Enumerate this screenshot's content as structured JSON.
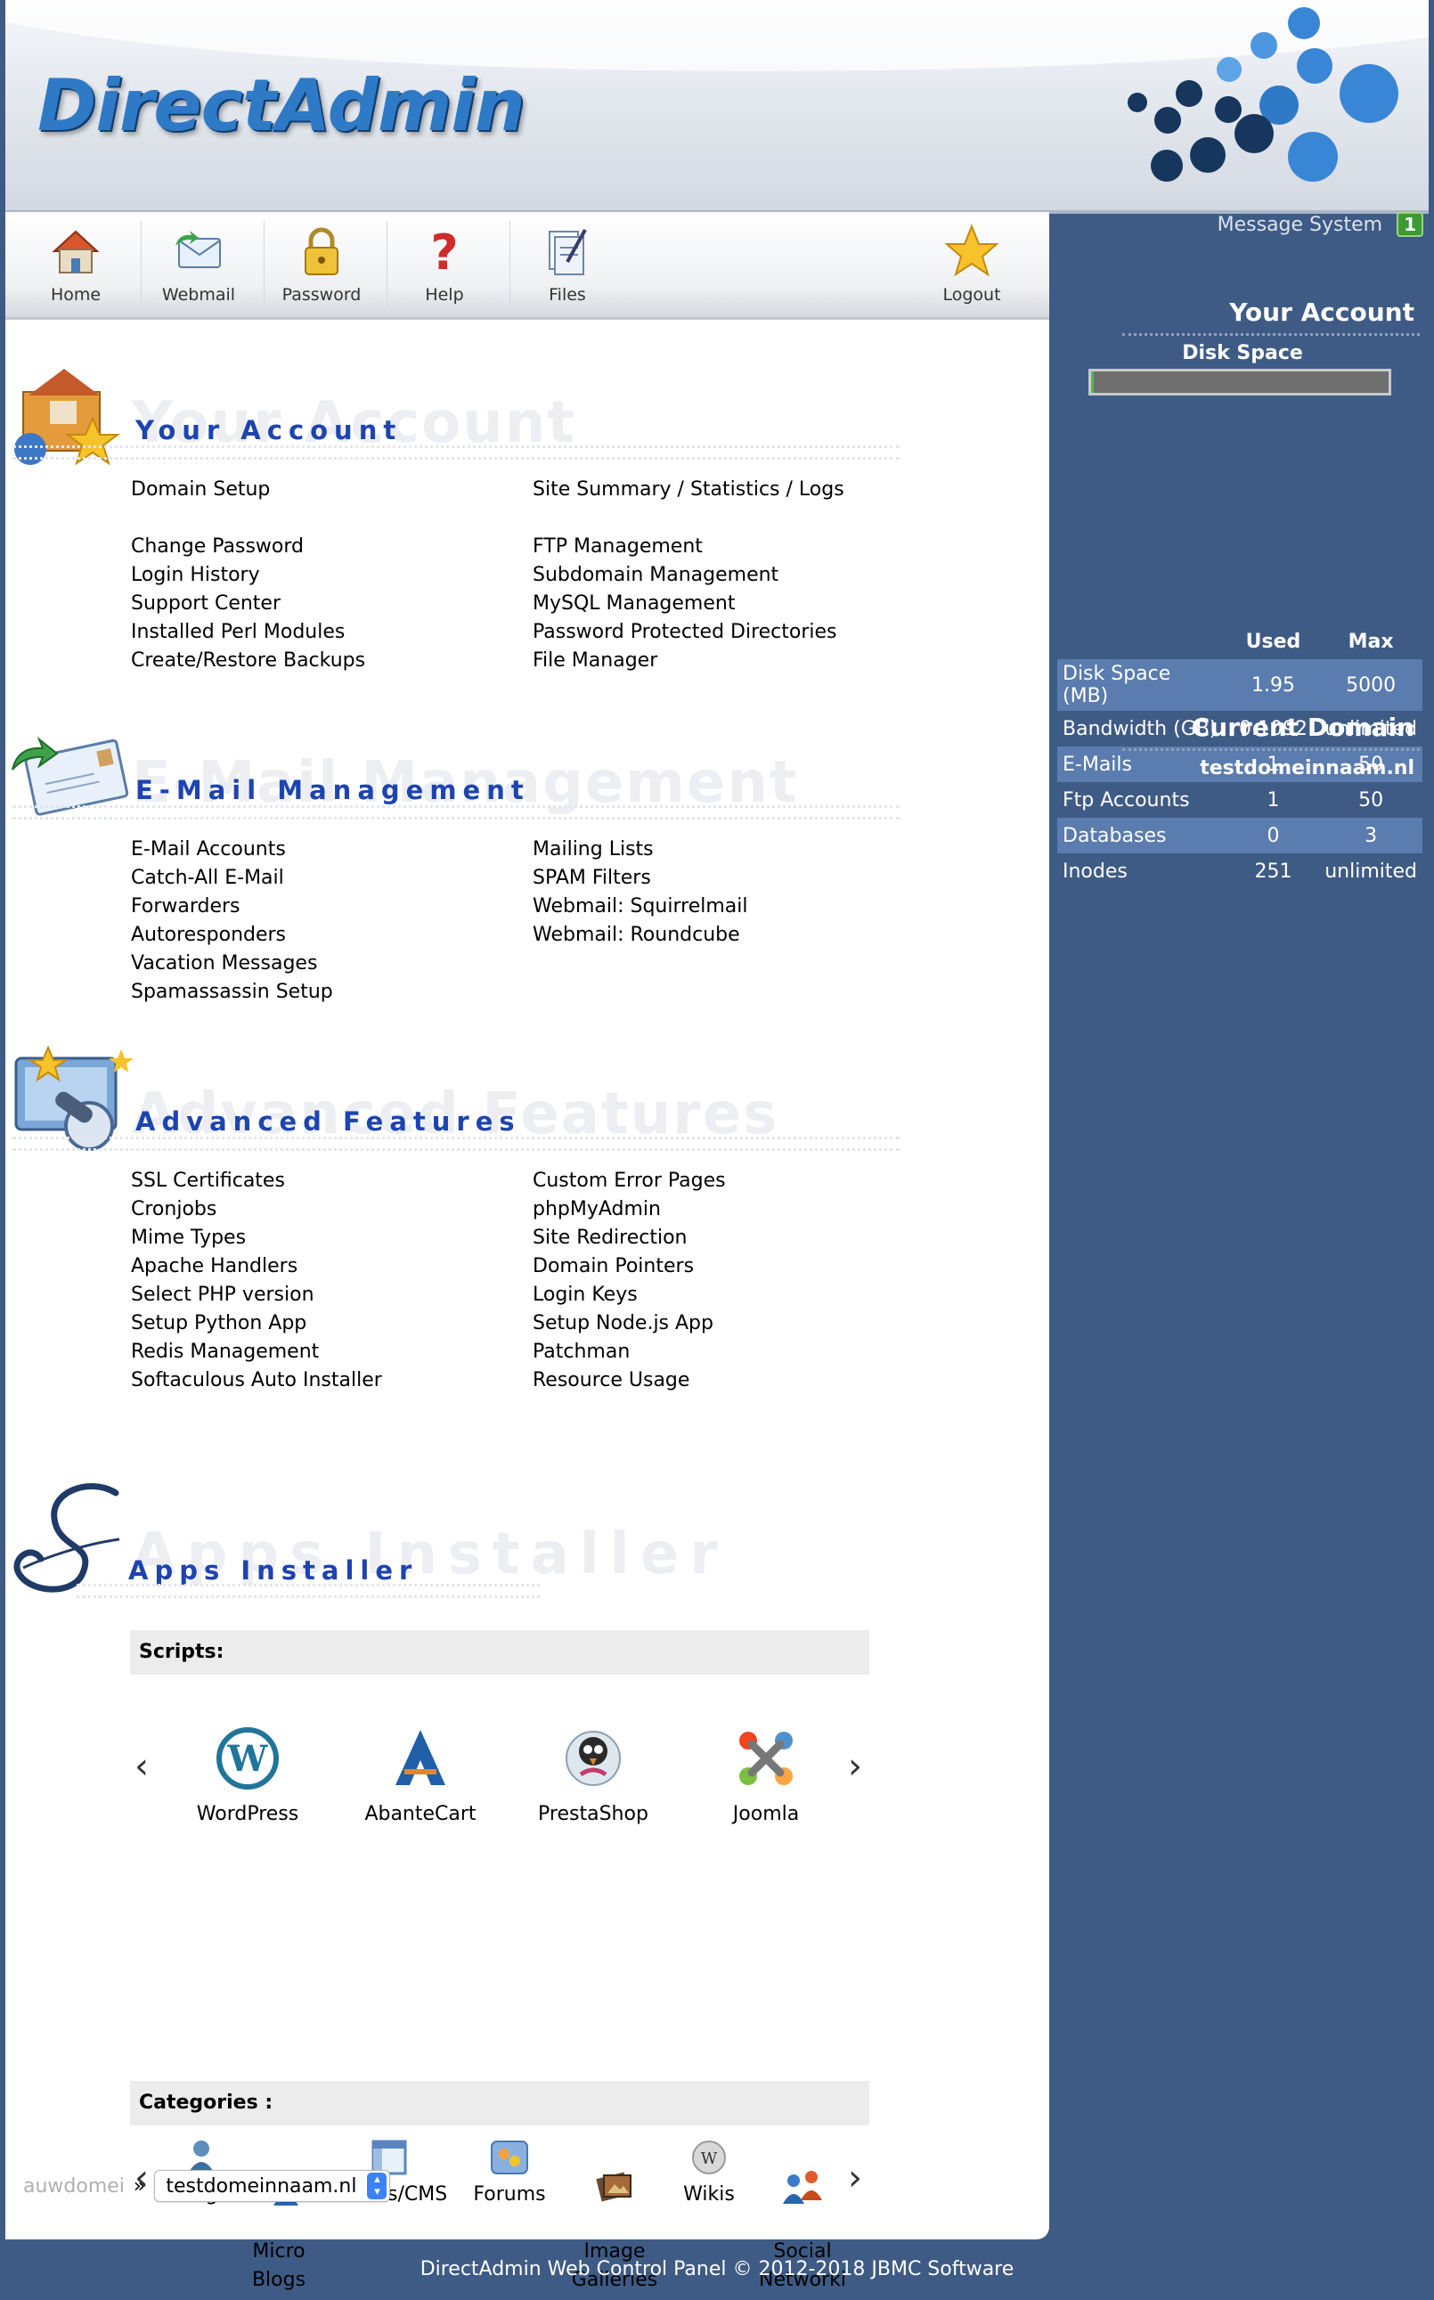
{
  "header": {
    "logo_text": "DirectAdmin"
  },
  "toolbar": {
    "home": "Home",
    "webmail": "Webmail",
    "password": "Password",
    "help": "Help",
    "files": "Files",
    "logout": "Logout"
  },
  "sections": {
    "account": {
      "title": "Your Account",
      "col1": [
        "Domain Setup",
        "",
        "Change Password",
        "Login History",
        "Support Center",
        "Installed Perl Modules",
        "Create/Restore Backups"
      ],
      "col2": [
        "Site Summary / Statistics / Logs",
        "",
        "FTP Management",
        "Subdomain Management",
        "MySQL Management",
        "Password Protected Directories",
        "File Manager"
      ]
    },
    "email": {
      "title": "E-Mail Management",
      "col1": [
        "E-Mail Accounts",
        "Catch-All E-Mail",
        "Forwarders",
        "Autoresponders",
        "Vacation Messages",
        "Spamassassin Setup"
      ],
      "col2": [
        "Mailing Lists",
        "SPAM Filters",
        "Webmail: Squirrelmail",
        "Webmail: Roundcube"
      ]
    },
    "advanced": {
      "title": "Advanced Features",
      "col1": [
        "SSL Certificates",
        "Cronjobs",
        "Mime Types",
        "Apache Handlers",
        "Select PHP version",
        "Setup Python App",
        "Redis Management",
        "Softaculous Auto Installer"
      ],
      "col2": [
        "Custom Error Pages",
        "phpMyAdmin",
        "Site Redirection",
        "Domain Pointers",
        "Login Keys",
        "Setup Node.js App",
        "Patchman",
        "Resource Usage"
      ]
    },
    "apps": {
      "title": "Apps Installer",
      "scripts_label": "Scripts:",
      "scripts": [
        "WordPress",
        "AbanteCart",
        "PrestaShop",
        "Joomla"
      ],
      "categories_label": "Categories :",
      "categories": [
        "Blogs",
        "Micro\nBlogs",
        "Portals/CMS",
        "Forums",
        "Image\nGalleries",
        "Wikis",
        "Social\nNetworki"
      ]
    }
  },
  "domain_selector": {
    "label": "auwdomei",
    "separator": "»",
    "value": "testdomeinnaam.nl"
  },
  "sidebar": {
    "message_system": "Message System",
    "message_count": "1",
    "your_account": "Your Account",
    "disk_space": "Disk Space",
    "disk_usage_fraction": 0.0004,
    "col_used": "Used",
    "col_max": "Max",
    "rows": [
      {
        "label": "Disk Space (MB)",
        "used": "1.95",
        "max": "5000"
      },
      {
        "label": "Bandwidth (GB)",
        "used": "0.1092",
        "max": "unlimited"
      },
      {
        "label": "E-Mails",
        "used": "1",
        "max": "50"
      },
      {
        "label": "Ftp Accounts",
        "used": "1",
        "max": "50"
      },
      {
        "label": "Databases",
        "used": "0",
        "max": "3"
      },
      {
        "label": "Inodes",
        "used": "251",
        "max": "unlimited"
      }
    ],
    "current_domain_label": "Current Domain",
    "current_domain": "testdomeinnaam.nl"
  },
  "footer": {
    "text": "DirectAdmin Web Control Panel © 2012-2018 JBMC Software"
  }
}
